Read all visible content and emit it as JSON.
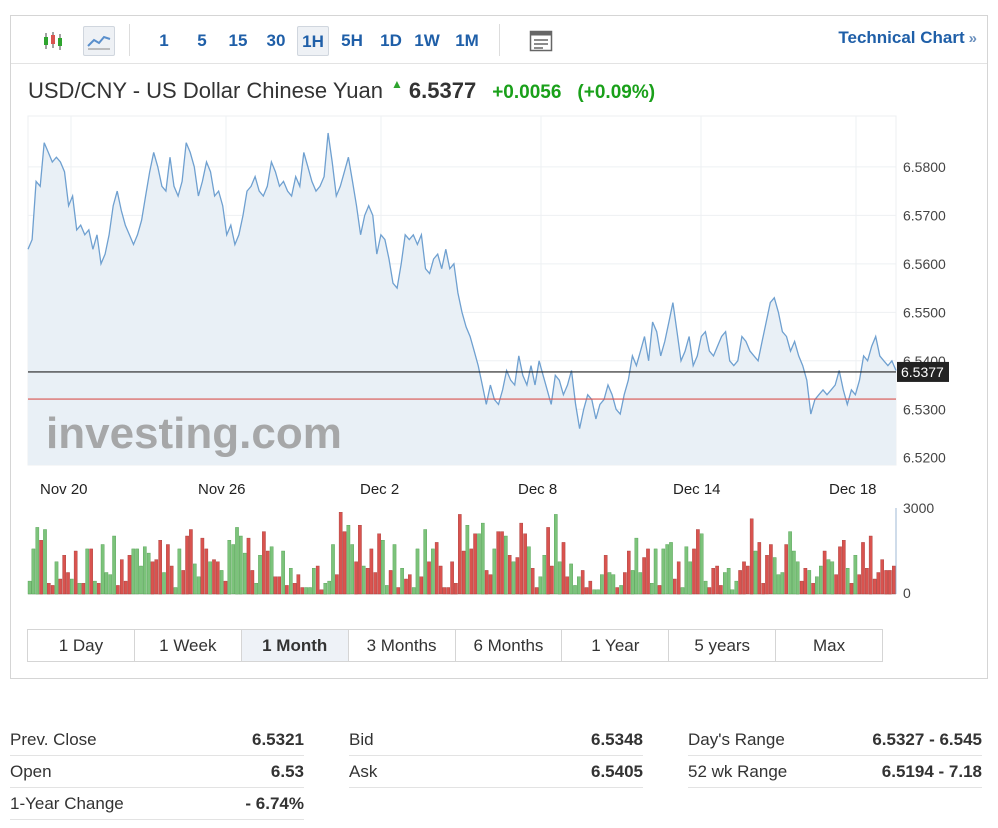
{
  "toolbar": {
    "intervals": [
      "1",
      "5",
      "15",
      "30",
      "1H",
      "5H",
      "1D",
      "1W",
      "1M"
    ],
    "active_interval": "1H",
    "technical_chart_label": "Technical Chart",
    "chev": "»"
  },
  "header": {
    "instrument": "USD/CNY - US Dollar Chinese Yuan",
    "price": "6.5377",
    "change": "+0.0056",
    "change_pct": "(+0.09%)",
    "up_color": "#1aa01a"
  },
  "chart_data": {
    "type": "area",
    "title": "",
    "xlabel": "",
    "ylabel": "",
    "ylim": [
      6.5185,
      6.5905
    ],
    "y_ticks": [
      "6.5800",
      "6.5700",
      "6.5600",
      "6.5500",
      "6.5400",
      "6.5300",
      "6.5200"
    ],
    "y_tick_values": [
      6.58,
      6.57,
      6.56,
      6.55,
      6.54,
      6.53,
      6.52
    ],
    "x_ticks": [
      "Nov 20",
      "Nov 26",
      "Dec 2",
      "Dec 8",
      "Dec 14",
      "Dec 18"
    ],
    "current_price": 6.5377,
    "current_price_label": "6.5377",
    "prev_close": 6.5321,
    "watermark": "investing.com",
    "series": [
      {
        "values": [
          6.563,
          6.565,
          6.577,
          6.576,
          6.585,
          6.583,
          6.581,
          6.582,
          6.581,
          6.579,
          6.572,
          6.574,
          6.567,
          6.568,
          6.566,
          6.567,
          6.563,
          6.566,
          6.56,
          6.562,
          6.566,
          6.572,
          6.575,
          6.571,
          6.568,
          6.566,
          6.564,
          6.566,
          6.569,
          6.574,
          6.579,
          6.583,
          6.58,
          6.576,
          6.575,
          6.582,
          6.576,
          6.574,
          6.577,
          6.585,
          6.583,
          6.58,
          6.574,
          6.577,
          6.581,
          6.579,
          6.574,
          6.575,
          6.572,
          6.566,
          6.568,
          6.564,
          6.566,
          6.57,
          6.575,
          6.576,
          6.578,
          6.575,
          6.574,
          6.576,
          6.581,
          6.579,
          6.576,
          6.577,
          6.575,
          6.574,
          6.578,
          6.576,
          6.583,
          6.58,
          6.577,
          6.575,
          6.576,
          6.578,
          6.587,
          6.581,
          6.574,
          6.576,
          6.579,
          6.582,
          6.577,
          6.572,
          6.566,
          6.57,
          6.572,
          6.57,
          6.562,
          6.566,
          6.565,
          6.561,
          6.556,
          6.555,
          6.56,
          6.566,
          6.565,
          6.566,
          6.564,
          6.566,
          6.559,
          6.558,
          6.561,
          6.562,
          6.559,
          6.563,
          6.559,
          6.56,
          6.554,
          6.55,
          6.547,
          6.545,
          6.542,
          6.539,
          6.535,
          6.531,
          6.535,
          6.532,
          6.531,
          6.534,
          6.538,
          6.536,
          6.535,
          6.541,
          6.537,
          6.535,
          6.539,
          6.535,
          6.54,
          6.537,
          6.534,
          6.531,
          6.537,
          6.536,
          6.533,
          6.535,
          6.538,
          6.531,
          6.526,
          6.53,
          6.533,
          6.532,
          6.528,
          6.531,
          6.532,
          6.535,
          6.533,
          6.53,
          6.529,
          6.533,
          6.536,
          6.541,
          6.539,
          6.542,
          6.545,
          6.54,
          6.548,
          6.546,
          6.541,
          6.544,
          6.548,
          6.552,
          6.546,
          6.54,
          6.542,
          6.545,
          6.539,
          6.541,
          6.545,
          6.546,
          6.542,
          6.541,
          6.543,
          6.545,
          6.546,
          6.54,
          6.539,
          6.54,
          6.545,
          6.544,
          6.542,
          6.541,
          6.54,
          6.544,
          6.548,
          6.552,
          6.553,
          6.55,
          6.546,
          6.545,
          6.542,
          6.544,
          6.541,
          6.539,
          6.536,
          6.529,
          6.532,
          6.533,
          6.534,
          6.533,
          6.534,
          6.535,
          6.538,
          6.534,
          6.531,
          6.534,
          6.533,
          6.536,
          6.541,
          6.54,
          6.543,
          6.545,
          6.541,
          6.54,
          6.539,
          6.54,
          6.538
        ]
      },
      {
        "name": "",
        "values": [
          6,
          21,
          31,
          25,
          30,
          5,
          4,
          15,
          7,
          18,
          10,
          7,
          20,
          5,
          5,
          21,
          21,
          6,
          5,
          23,
          10,
          9,
          27,
          4,
          16,
          6,
          18,
          21,
          21,
          13,
          22,
          19,
          15,
          16,
          25,
          10,
          23,
          13,
          3,
          21,
          11,
          27,
          30,
          14,
          8,
          26,
          21,
          15,
          16,
          15,
          11,
          6,
          25,
          23,
          31,
          27,
          19,
          26,
          11,
          5,
          18,
          29,
          20,
          22,
          8,
          8,
          20,
          4,
          12,
          5,
          9,
          3,
          3,
          3,
          12,
          13,
          2,
          5,
          6,
          23,
          9,
          38,
          29,
          32,
          23,
          15,
          32,
          13,
          12,
          21,
          10,
          28,
          25,
          4,
          11,
          23,
          3,
          12,
          7,
          9,
          3,
          21,
          8,
          30,
          15,
          21,
          24,
          13,
          3,
          3,
          15,
          5,
          37,
          20,
          32,
          21,
          28,
          28,
          33,
          11,
          9,
          21,
          29,
          29,
          27,
          18,
          15,
          17,
          33,
          28,
          22,
          12,
          3,
          8,
          18,
          31,
          13,
          37,
          15,
          24,
          8,
          14,
          4,
          8,
          11,
          3,
          6,
          2,
          2,
          9,
          18,
          10,
          9,
          3,
          4,
          10,
          20,
          11,
          26,
          10,
          17,
          21,
          5,
          21,
          4,
          21,
          23,
          24,
          7,
          15,
          3,
          22,
          15,
          21,
          30,
          28,
          6,
          3,
          12,
          13,
          4,
          10,
          12,
          2,
          6,
          11,
          15,
          13,
          35,
          20,
          24,
          5,
          18,
          23,
          17,
          9,
          10,
          23,
          29,
          20,
          15,
          6,
          12,
          11,
          5,
          8,
          13,
          20,
          16,
          15,
          9,
          22,
          25,
          12,
          5,
          18,
          9,
          24,
          12,
          27,
          7,
          10,
          16,
          11,
          11,
          13
        ]
      }
    ],
    "volume_ticks": [
      "3000",
      "0"
    ],
    "volume_up_color": "#7cc37b",
    "volume_down_color": "#d9534f",
    "line_color": "#6fa0d0",
    "area_color": "#e9f0f6"
  },
  "ranges": {
    "items": [
      "1 Day",
      "1 Week",
      "1 Month",
      "3 Months",
      "6 Months",
      "1 Year",
      "5 years",
      "Max"
    ],
    "active": "1 Month"
  },
  "stats": {
    "col1": [
      {
        "label": "Prev. Close",
        "value": "6.5321"
      },
      {
        "label": "Open",
        "value": "6.53"
      },
      {
        "label": "1-Year Change",
        "value": "- 6.74%"
      }
    ],
    "col2": [
      {
        "label": "Bid",
        "value": "6.5348"
      },
      {
        "label": "Ask",
        "value": "6.5405"
      }
    ],
    "col3": [
      {
        "label": "Day's Range",
        "value": "6.5327 - 6.545"
      },
      {
        "label": "52 wk Range",
        "value": "6.5194 - 7.18"
      }
    ]
  }
}
